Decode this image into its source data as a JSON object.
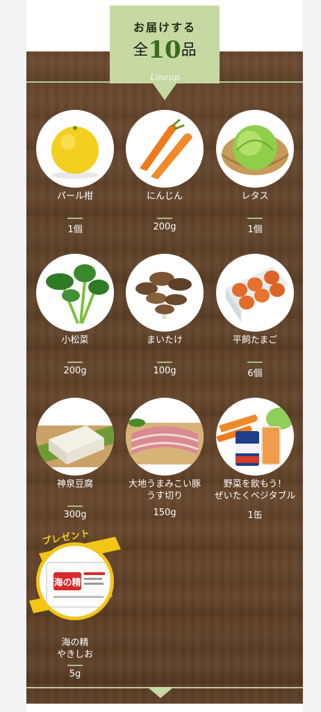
{
  "header": {
    "title": "お届けする",
    "count_prefix": "全",
    "count_number": "10",
    "count_suffix": "品",
    "subtitle": "Lineup"
  },
  "products": [
    {
      "name": "パール柑",
      "qty": "1個",
      "icon": "pearl-citrus"
    },
    {
      "name": "にんじん",
      "qty": "200g",
      "icon": "carrot"
    },
    {
      "name": "レタス",
      "qty": "1個",
      "icon": "lettuce"
    },
    {
      "name": "小松菜",
      "qty": "200g",
      "icon": "komatsuna"
    },
    {
      "name": "まいたけ",
      "qty": "100g",
      "icon": "maitake"
    },
    {
      "name": "平飼たまご",
      "qty": "6個",
      "icon": "eggs"
    },
    {
      "name": "神泉豆腐",
      "qty": "300g",
      "icon": "tofu"
    },
    {
      "name_line1": "大地うまみこい豚",
      "name_line2": "うす切り",
      "qty": "150g",
      "icon": "pork"
    },
    {
      "name_line1": "野菜を飲もう！",
      "name_line2": "ぜいたくベジタブル",
      "qty": "1缶",
      "icon": "vegetable-juice"
    }
  ],
  "present": {
    "ribbon": "プレゼント",
    "name_line1": "海の精",
    "name_line2": "やきしお",
    "qty": "5g",
    "icon": "salt-pack",
    "package_label": "海の精"
  },
  "colors": {
    "board": "#5f4129",
    "accent_green": "#c9d9a8",
    "badge_green": "#3a6a1d",
    "ribbon_yellow": "#f2c518"
  }
}
